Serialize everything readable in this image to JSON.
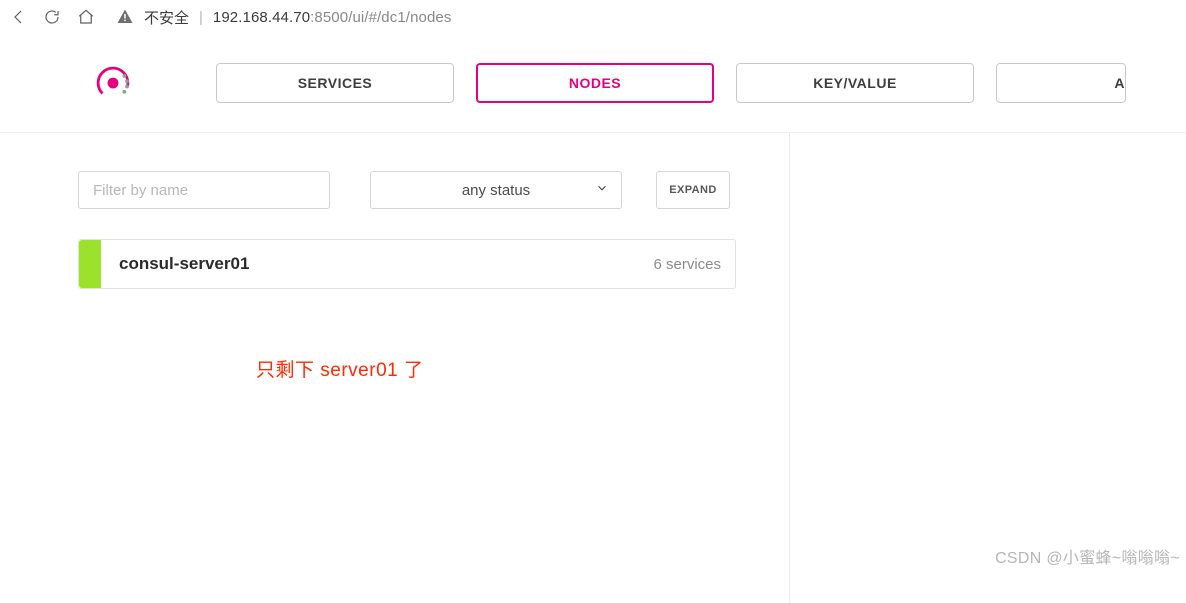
{
  "browser": {
    "insecure_label": "不安全",
    "url_host": "192.168.44.70",
    "url_port_path": ":8500/ui/#/dc1/nodes"
  },
  "header": {
    "tabs": {
      "services": "SERVICES",
      "nodes": "NODES",
      "keyvalue": "KEY/VALUE",
      "acl": "ACL"
    }
  },
  "controls": {
    "filter_placeholder": "Filter by name",
    "status_select": "any status",
    "expand_label": "EXPAND"
  },
  "nodes": [
    {
      "name": "consul-server01",
      "services_text": "6 services",
      "status_color": "#9ce12a"
    }
  ],
  "annotation": "只剩下 server01 了",
  "watermark": "CSDN @小蜜蜂~嗡嗡嗡~",
  "colors": {
    "accent": "#e6007e",
    "status_ok": "#9ce12a",
    "annotation": "#ff2a00"
  }
}
